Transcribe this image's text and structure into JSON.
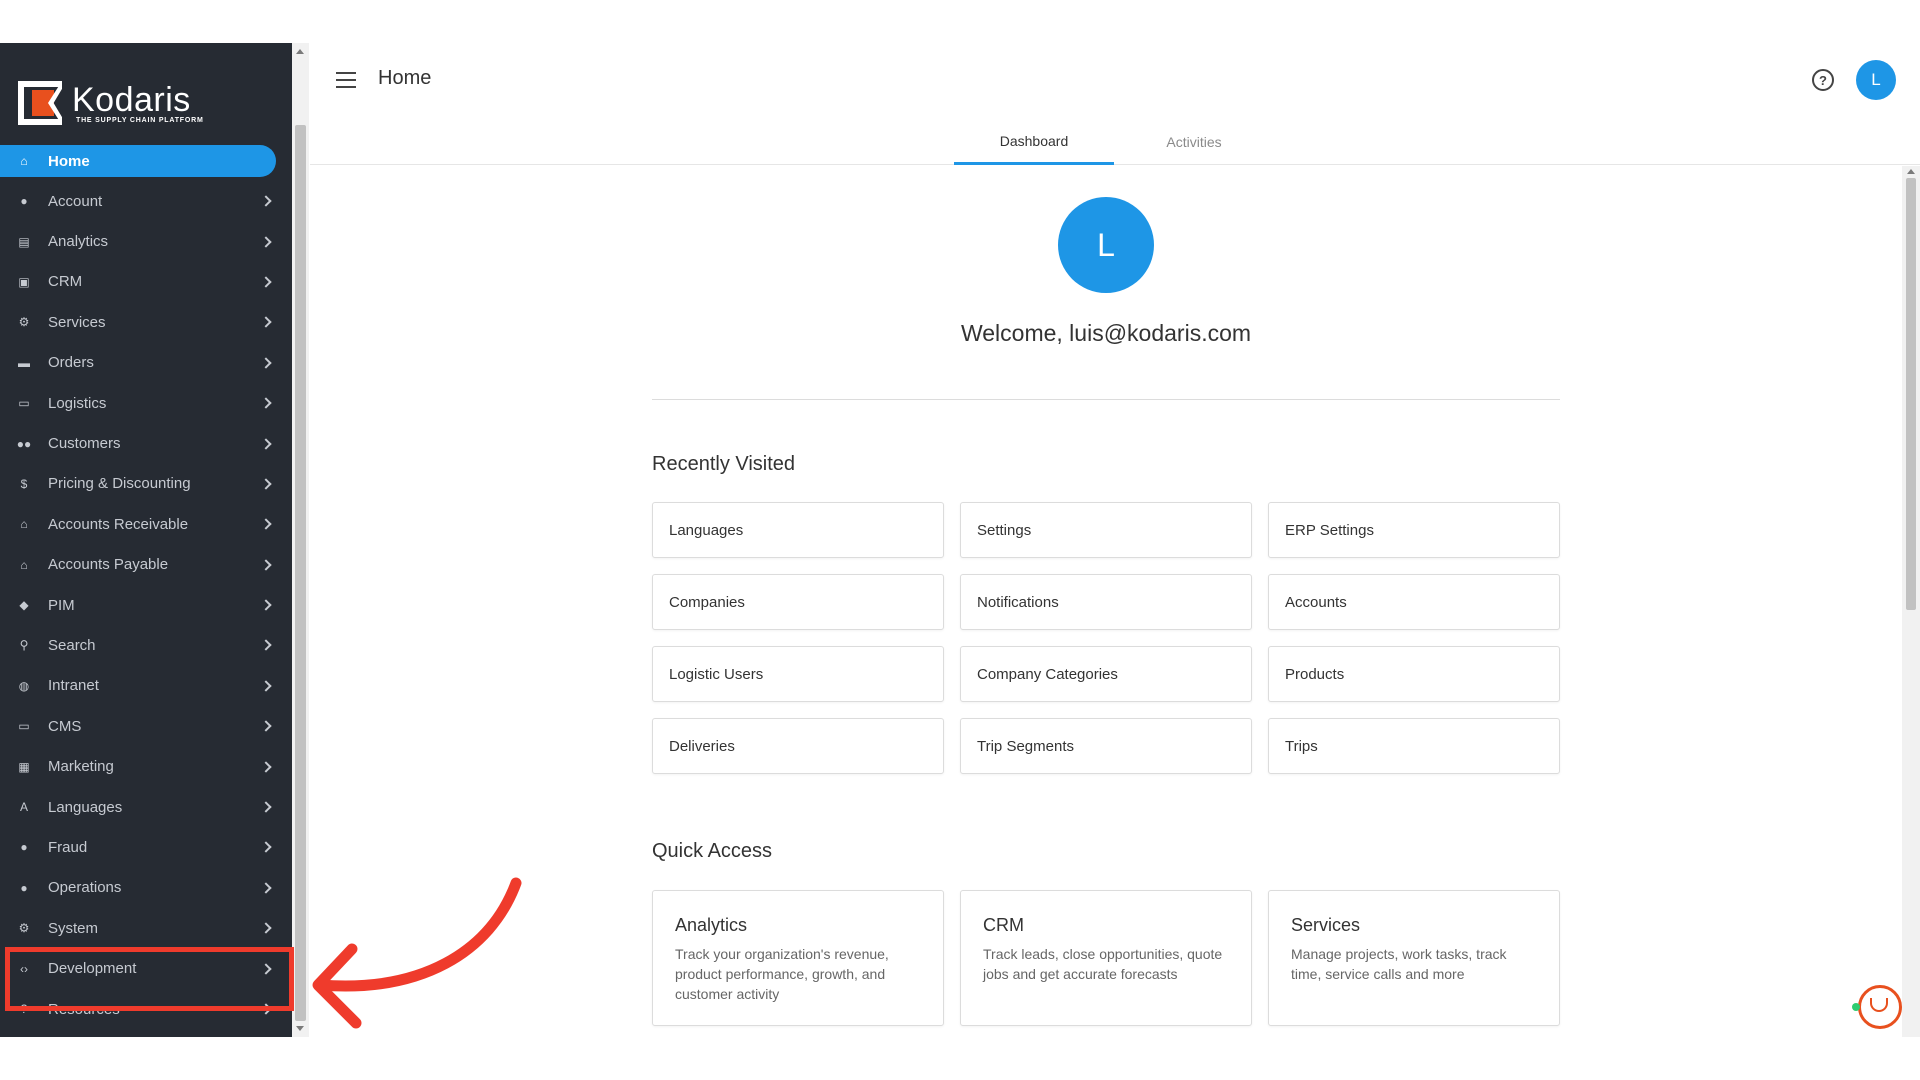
{
  "brand": {
    "name": "Kodaris",
    "tagline": "THE SUPPLY CHAIN PLATFORM"
  },
  "header": {
    "title": "Home",
    "help_icon": "?",
    "avatar_letter": "L"
  },
  "tabs": [
    {
      "label": "Dashboard",
      "active": true
    },
    {
      "label": "Activities",
      "active": false
    }
  ],
  "sidebar": {
    "items": [
      {
        "label": "Home",
        "icon": "home-icon",
        "active": true
      },
      {
        "label": "Account",
        "icon": "user-icon"
      },
      {
        "label": "Analytics",
        "icon": "chart-icon"
      },
      {
        "label": "CRM",
        "icon": "contact-card-icon"
      },
      {
        "label": "Services",
        "icon": "gears-icon"
      },
      {
        "label": "Orders",
        "icon": "truck-icon"
      },
      {
        "label": "Logistics",
        "icon": "delivery-icon"
      },
      {
        "label": "Customers",
        "icon": "people-icon"
      },
      {
        "label": "Pricing & Discounting",
        "icon": "dollar-icon"
      },
      {
        "label": "Accounts Receivable",
        "icon": "bank-icon"
      },
      {
        "label": "Accounts Payable",
        "icon": "bank-icon"
      },
      {
        "label": "PIM",
        "icon": "tag-icon"
      },
      {
        "label": "Search",
        "icon": "search-icon"
      },
      {
        "label": "Intranet",
        "icon": "globe-icon"
      },
      {
        "label": "CMS",
        "icon": "window-icon"
      },
      {
        "label": "Marketing",
        "icon": "megaphone-icon"
      },
      {
        "label": "Languages",
        "icon": "translate-icon"
      },
      {
        "label": "Fraud",
        "icon": "alert-icon"
      },
      {
        "label": "Operations",
        "icon": "operations-icon"
      },
      {
        "label": "System",
        "icon": "gear-icon"
      },
      {
        "label": "Development",
        "icon": "code-icon"
      },
      {
        "label": "Resources",
        "icon": "help-circle-icon"
      }
    ]
  },
  "dashboard": {
    "avatar_letter": "L",
    "welcome": "Welcome, luis@kodaris.com",
    "recently_visited_title": "Recently Visited",
    "recently_visited": [
      "Languages",
      "Settings",
      "ERP Settings",
      "Companies",
      "Notifications",
      "Accounts",
      "Logistic Users",
      "Company Categories",
      "Products",
      "Deliveries",
      "Trip Segments",
      "Trips"
    ],
    "quick_access_title": "Quick Access",
    "quick_access": [
      {
        "title": "Analytics",
        "desc": "Track your organization's revenue, product performance, growth, and customer activity"
      },
      {
        "title": "CRM",
        "desc": "Track leads, close opportunities, quote jobs and get accurate forecasts"
      },
      {
        "title": "Services",
        "desc": "Manage projects, work tasks, track time, service calls and more"
      }
    ]
  },
  "colors": {
    "sidebar_bg": "#262b33",
    "accent": "#1e96e6",
    "brand_orange": "#e8501e",
    "annotation_red": "#ef3b2c"
  }
}
